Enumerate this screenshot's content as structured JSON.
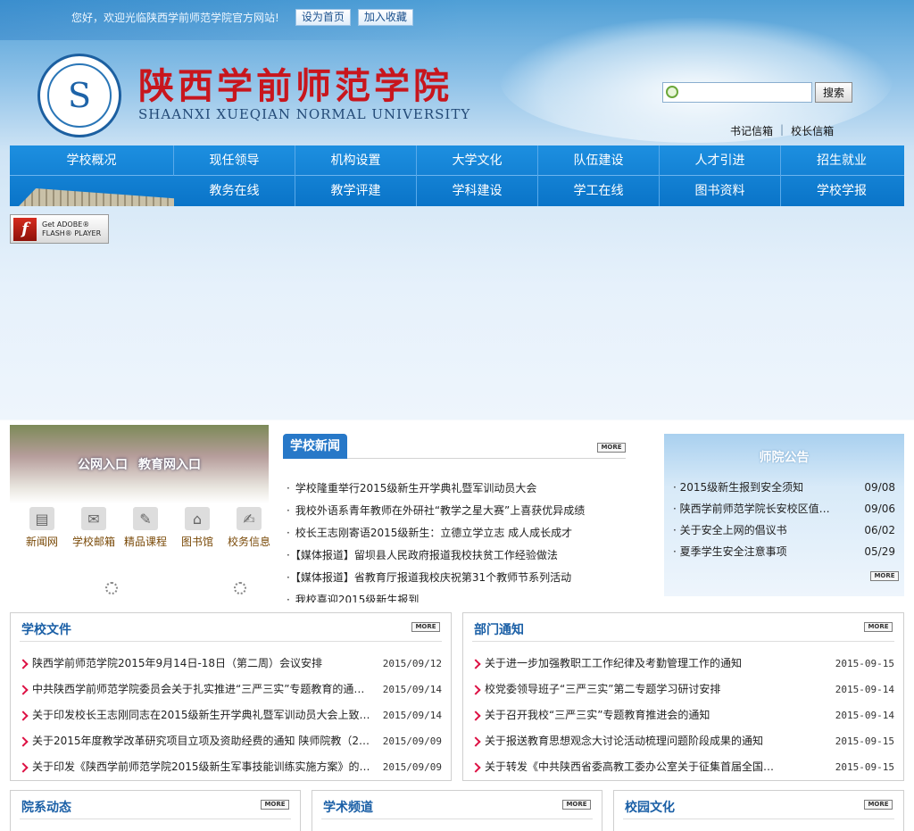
{
  "topbar": {
    "welcome": "您好，欢迎光临陕西学前师范学院官方网站!",
    "set_home": "设为首页",
    "add_fav": "加入收藏"
  },
  "brand": {
    "logo_char": "S",
    "title_cn": "陕西学前师范学院",
    "title_en": "SHAANXI XUEQIAN NORMAL UNIVERSITY"
  },
  "search": {
    "button": "搜索",
    "placeholder": ""
  },
  "mailbox": {
    "secretary": "书记信箱",
    "separator": "|",
    "president": "校长信箱"
  },
  "nav": {
    "row1": [
      "学校概况",
      "现任领导",
      "机构设置",
      "大学文化",
      "队伍建设",
      "人才引进",
      "招生就业"
    ],
    "row2": [
      "教务在线",
      "教学评建",
      "学科建设",
      "学工在线",
      "图书资料",
      "学校学报"
    ]
  },
  "flash": {
    "line1": "Get ADOBE®",
    "line2": "FLASH® PLAYER",
    "icon": "f"
  },
  "portal": {
    "public": "公网入口",
    "edu": "教育网入口"
  },
  "quick": [
    {
      "label": "新闻网",
      "icon": "newspaper-icon"
    },
    {
      "label": "学校邮箱",
      "icon": "mail-icon"
    },
    {
      "label": "精品课程",
      "icon": "course-icon"
    },
    {
      "label": "图书馆",
      "icon": "library-icon"
    },
    {
      "label": "校务信息",
      "icon": "info-icon"
    }
  ],
  "more_label": "MORE",
  "school_news": {
    "title": "学校新闻",
    "items": [
      "学校隆重举行2015级新生开学典礼暨军训动员大会",
      "我校外语系青年教师在外研社“教学之星大赛”上喜获优异成绩",
      "校长王志刚寄语2015级新生：立德立学立志 成人成长成才",
      "【媒体报道】留坝县人民政府报道我校扶贫工作经验做法",
      "【媒体报道】省教育厅报道我校庆祝第31个教师节系列活动",
      "我校喜迎2015级新生报到"
    ]
  },
  "announcement": {
    "title": "师院公告",
    "items": [
      {
        "text": "2015级新生报到安全须知",
        "date": "09/08"
      },
      {
        "text": "陕西学前师范学院长安校区值…",
        "date": "09/06"
      },
      {
        "text": "关于安全上网的倡议书",
        "date": "06/02"
      },
      {
        "text": "夏季学生安全注意事项",
        "date": "05/29"
      }
    ]
  },
  "school_docs": {
    "title": "学校文件",
    "items": [
      {
        "text": "陕西学前师范学院2015年9月14日-18日（第二周）会议安排",
        "date": "2015/09/12"
      },
      {
        "text": "中共陕西学前师范学院委员会关于扎实推进“三严三实”专题教育的通…",
        "date": "2015/09/14"
      },
      {
        "text": "关于印发校长王志刚同志在2015级新生开学典礼暨军训动员大会上致辞…",
        "date": "2015/09/14"
      },
      {
        "text": "关于2015年度教学改革研究项目立项及资助经费的通知 陕师院教（201…",
        "date": "2015/09/09"
      },
      {
        "text": "关于印发《陕西学前师范学院2015级新生军事技能训练实施方案》的通…",
        "date": "2015/09/09"
      }
    ]
  },
  "dept_notices": {
    "title": "部门通知",
    "items": [
      {
        "text": "关于进一步加强教职工工作纪律及考勤管理工作的通知",
        "date": "2015-09-15"
      },
      {
        "text": "校党委领导班子“三严三实”第二专题学习研讨安排",
        "date": "2015-09-14"
      },
      {
        "text": "关于召开我校“三严三实”专题教育推进会的通知",
        "date": "2015-09-14"
      },
      {
        "text": "关于报送教育思想观念大讨论活动梳理问题阶段成果的通知",
        "date": "2015-09-15"
      },
      {
        "text": "关于转发《中共陕西省委高教工委办公室关于征集首届全国…",
        "date": "2015-09-15"
      }
    ]
  },
  "bottom": {
    "dept_news": "院系动态",
    "academic": "学术频道",
    "campus": "校园文化"
  },
  "colors": {
    "nav": "#0a74c8",
    "brand_red": "#c8161d",
    "link_blue": "#1a5fa6"
  }
}
